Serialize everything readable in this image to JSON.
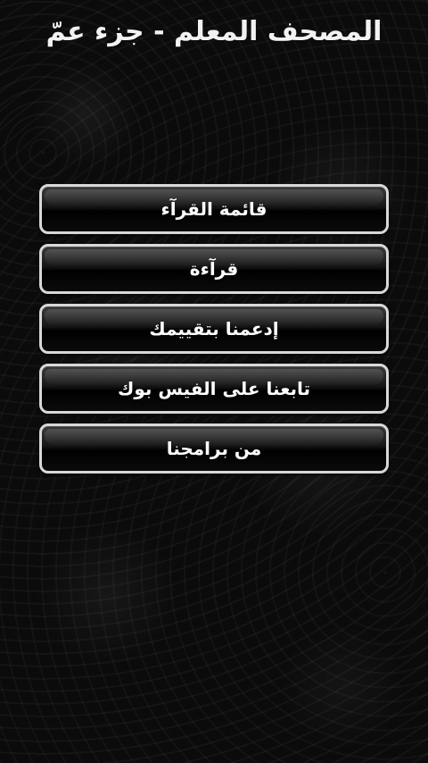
{
  "app": {
    "title": "المصحف المعلم - جزء عمّ"
  },
  "menu": [
    {
      "label": "قائمة القرآء"
    },
    {
      "label": "قرآءة"
    },
    {
      "label": "إدعمنا بتقييمك"
    },
    {
      "label": "تابعنا على الفيس بوك"
    },
    {
      "label": "من برامجنا"
    }
  ]
}
